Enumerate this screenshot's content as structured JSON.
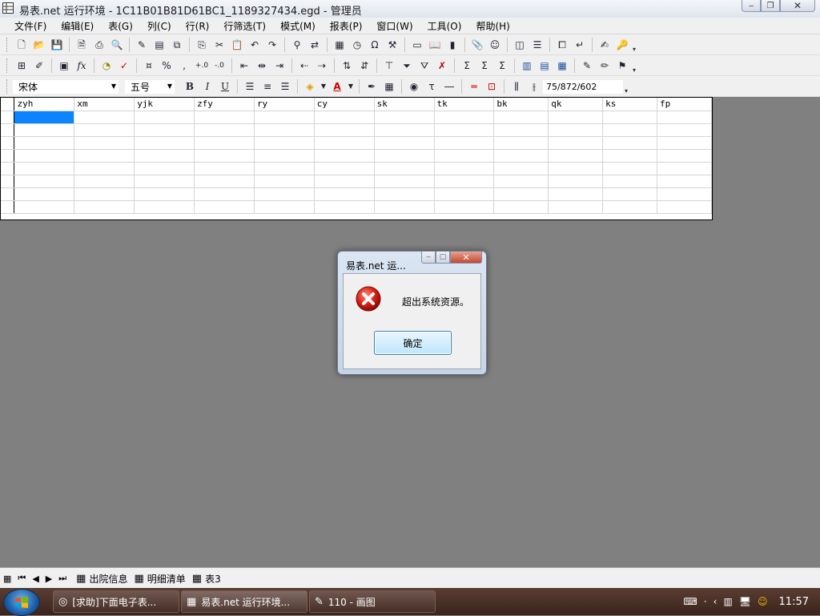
{
  "window": {
    "title": "易表.net 运行环境  -  1C11B01B81D61BC1_1189327434.egd  -  管理员",
    "controls": [
      "‒",
      "❐",
      "✕"
    ]
  },
  "menu": [
    "文件(F)",
    "编辑(E)",
    "表(G)",
    "列(C)",
    "行(R)",
    "行筛选(T)",
    "模式(M)",
    "报表(P)",
    "窗口(W)",
    "工具(O)",
    "帮助(H)"
  ],
  "toolbar": {
    "font_name": "宋体",
    "font_size": "五号",
    "cell_position": "75/872/602",
    "bold": "B",
    "italic": "I",
    "underline": "U"
  },
  "grid": {
    "columns": [
      "zyh",
      "xm",
      "yjk",
      "zfy",
      "ry",
      "cy",
      "sk",
      "tk",
      "bk",
      "qk",
      "ks",
      "fp"
    ],
    "row_count": 8,
    "selected_cell": "zyh-1"
  },
  "dialog": {
    "title": "易表.net 运...",
    "message": "超出系统资源。",
    "ok_label": "确定",
    "icon": "error-icon"
  },
  "sheets": {
    "tabs": [
      "出院信息",
      "明细清单",
      "表3"
    ]
  },
  "taskbar": {
    "items": [
      {
        "label": "[求助]下面电子表..."
      },
      {
        "label": "易表.net 运行环境..."
      },
      {
        "label": "110 - 画图"
      }
    ],
    "clock": "11:57"
  },
  "colors": {
    "workspace": "#808080",
    "selection": "#0a84ff",
    "taskbar": "#4a2f25"
  }
}
